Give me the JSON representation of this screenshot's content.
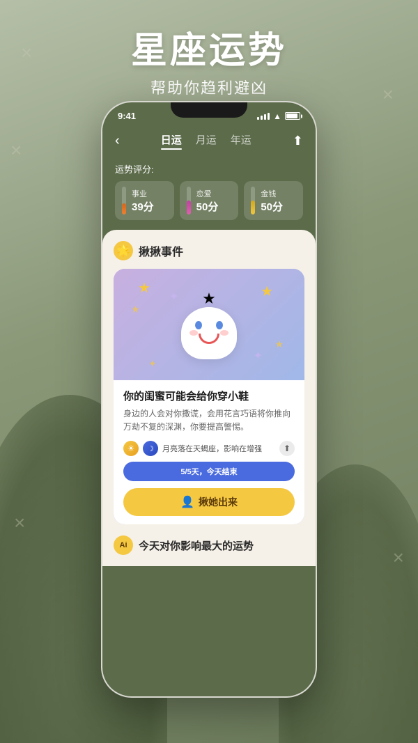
{
  "background": {
    "xmarks": [
      "×",
      "×",
      "×",
      "×",
      "×"
    ]
  },
  "title": {
    "main": "星座运势",
    "sub": "帮助你趋利避凶"
  },
  "phone": {
    "statusBar": {
      "time": "9:41",
      "signalBars": [
        3,
        5,
        7,
        9,
        11
      ],
      "wifiSymbol": "WiFi",
      "batteryPercent": 90
    },
    "nav": {
      "backIcon": "‹",
      "tabs": [
        "日运",
        "月运",
        "年运"
      ],
      "activeTab": 0,
      "shareIcon": "⬆"
    },
    "scoreSection": {
      "label": "运势评分:",
      "cards": [
        {
          "name": "事业",
          "value": "39分",
          "fillHeight": "39%",
          "color": "#f08030"
        },
        {
          "name": "恋爱",
          "value": "50分",
          "fillHeight": "50%",
          "color": "#e060b0"
        },
        {
          "name": "金钱",
          "value": "50分",
          "fillHeight": "50%",
          "color": "#f0c840"
        }
      ]
    },
    "eventSection": {
      "iconEmoji": "🌟",
      "title": "揪揪事件",
      "card": {
        "eventTitle": "你的闺蜜可能会给你穿小鞋",
        "eventDesc": "身边的人会对你撒谎，会用花言巧语将你推向万劫不复的深渊，你要提高警惕。",
        "planetText": "月亮落在天蝎座，影响在增强",
        "progressText": "5/5天，今天结束",
        "actionBtnText": "揪她出来",
        "actionIcon": "👤"
      }
    },
    "bottomSection": {
      "aiBadgeText": "Ai",
      "title": "今天对你影响最大的运势"
    }
  }
}
